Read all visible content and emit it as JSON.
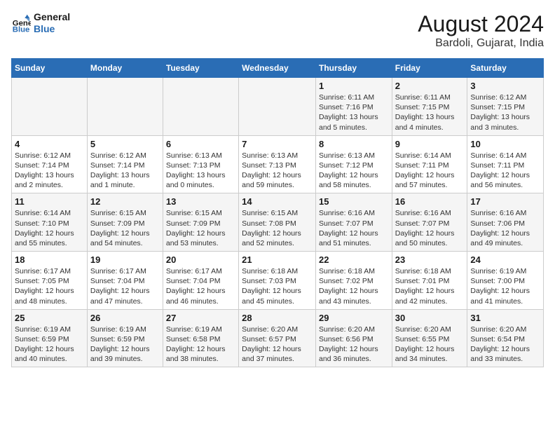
{
  "logo": {
    "line1": "General",
    "line2": "Blue"
  },
  "title": "August 2024",
  "subtitle": "Bardoli, Gujarat, India",
  "days_of_week": [
    "Sunday",
    "Monday",
    "Tuesday",
    "Wednesday",
    "Thursday",
    "Friday",
    "Saturday"
  ],
  "weeks": [
    [
      {
        "day": "",
        "info": ""
      },
      {
        "day": "",
        "info": ""
      },
      {
        "day": "",
        "info": ""
      },
      {
        "day": "",
        "info": ""
      },
      {
        "day": "1",
        "info": "Sunrise: 6:11 AM\nSunset: 7:16 PM\nDaylight: 13 hours\nand 5 minutes."
      },
      {
        "day": "2",
        "info": "Sunrise: 6:11 AM\nSunset: 7:15 PM\nDaylight: 13 hours\nand 4 minutes."
      },
      {
        "day": "3",
        "info": "Sunrise: 6:12 AM\nSunset: 7:15 PM\nDaylight: 13 hours\nand 3 minutes."
      }
    ],
    [
      {
        "day": "4",
        "info": "Sunrise: 6:12 AM\nSunset: 7:14 PM\nDaylight: 13 hours\nand 2 minutes."
      },
      {
        "day": "5",
        "info": "Sunrise: 6:12 AM\nSunset: 7:14 PM\nDaylight: 13 hours\nand 1 minute."
      },
      {
        "day": "6",
        "info": "Sunrise: 6:13 AM\nSunset: 7:13 PM\nDaylight: 13 hours\nand 0 minutes."
      },
      {
        "day": "7",
        "info": "Sunrise: 6:13 AM\nSunset: 7:13 PM\nDaylight: 12 hours\nand 59 minutes."
      },
      {
        "day": "8",
        "info": "Sunrise: 6:13 AM\nSunset: 7:12 PM\nDaylight: 12 hours\nand 58 minutes."
      },
      {
        "day": "9",
        "info": "Sunrise: 6:14 AM\nSunset: 7:11 PM\nDaylight: 12 hours\nand 57 minutes."
      },
      {
        "day": "10",
        "info": "Sunrise: 6:14 AM\nSunset: 7:11 PM\nDaylight: 12 hours\nand 56 minutes."
      }
    ],
    [
      {
        "day": "11",
        "info": "Sunrise: 6:14 AM\nSunset: 7:10 PM\nDaylight: 12 hours\nand 55 minutes."
      },
      {
        "day": "12",
        "info": "Sunrise: 6:15 AM\nSunset: 7:09 PM\nDaylight: 12 hours\nand 54 minutes."
      },
      {
        "day": "13",
        "info": "Sunrise: 6:15 AM\nSunset: 7:09 PM\nDaylight: 12 hours\nand 53 minutes."
      },
      {
        "day": "14",
        "info": "Sunrise: 6:15 AM\nSunset: 7:08 PM\nDaylight: 12 hours\nand 52 minutes."
      },
      {
        "day": "15",
        "info": "Sunrise: 6:16 AM\nSunset: 7:07 PM\nDaylight: 12 hours\nand 51 minutes."
      },
      {
        "day": "16",
        "info": "Sunrise: 6:16 AM\nSunset: 7:07 PM\nDaylight: 12 hours\nand 50 minutes."
      },
      {
        "day": "17",
        "info": "Sunrise: 6:16 AM\nSunset: 7:06 PM\nDaylight: 12 hours\nand 49 minutes."
      }
    ],
    [
      {
        "day": "18",
        "info": "Sunrise: 6:17 AM\nSunset: 7:05 PM\nDaylight: 12 hours\nand 48 minutes."
      },
      {
        "day": "19",
        "info": "Sunrise: 6:17 AM\nSunset: 7:04 PM\nDaylight: 12 hours\nand 47 minutes."
      },
      {
        "day": "20",
        "info": "Sunrise: 6:17 AM\nSunset: 7:04 PM\nDaylight: 12 hours\nand 46 minutes."
      },
      {
        "day": "21",
        "info": "Sunrise: 6:18 AM\nSunset: 7:03 PM\nDaylight: 12 hours\nand 45 minutes."
      },
      {
        "day": "22",
        "info": "Sunrise: 6:18 AM\nSunset: 7:02 PM\nDaylight: 12 hours\nand 43 minutes."
      },
      {
        "day": "23",
        "info": "Sunrise: 6:18 AM\nSunset: 7:01 PM\nDaylight: 12 hours\nand 42 minutes."
      },
      {
        "day": "24",
        "info": "Sunrise: 6:19 AM\nSunset: 7:00 PM\nDaylight: 12 hours\nand 41 minutes."
      }
    ],
    [
      {
        "day": "25",
        "info": "Sunrise: 6:19 AM\nSunset: 6:59 PM\nDaylight: 12 hours\nand 40 minutes."
      },
      {
        "day": "26",
        "info": "Sunrise: 6:19 AM\nSunset: 6:59 PM\nDaylight: 12 hours\nand 39 minutes."
      },
      {
        "day": "27",
        "info": "Sunrise: 6:19 AM\nSunset: 6:58 PM\nDaylight: 12 hours\nand 38 minutes."
      },
      {
        "day": "28",
        "info": "Sunrise: 6:20 AM\nSunset: 6:57 PM\nDaylight: 12 hours\nand 37 minutes."
      },
      {
        "day": "29",
        "info": "Sunrise: 6:20 AM\nSunset: 6:56 PM\nDaylight: 12 hours\nand 36 minutes."
      },
      {
        "day": "30",
        "info": "Sunrise: 6:20 AM\nSunset: 6:55 PM\nDaylight: 12 hours\nand 34 minutes."
      },
      {
        "day": "31",
        "info": "Sunrise: 6:20 AM\nSunset: 6:54 PM\nDaylight: 12 hours\nand 33 minutes."
      }
    ]
  ]
}
